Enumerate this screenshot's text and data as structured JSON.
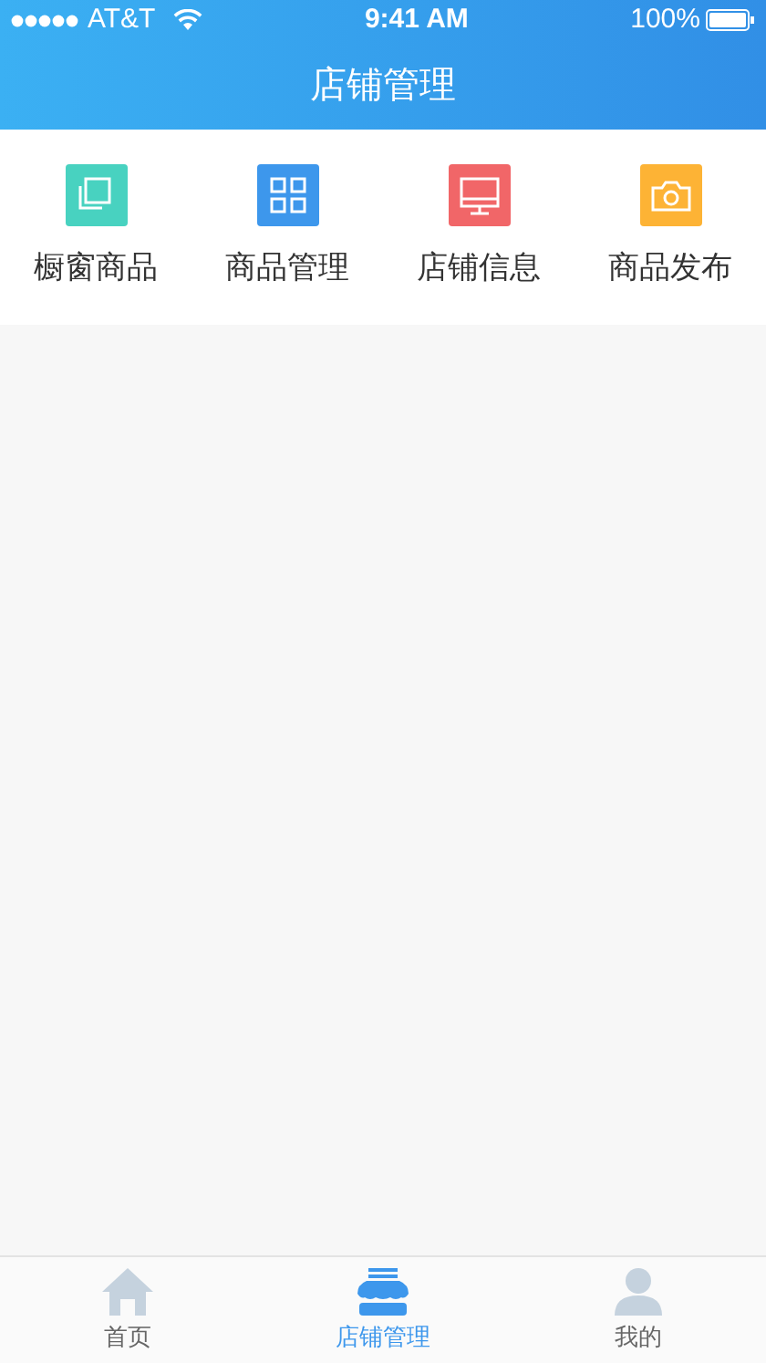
{
  "status_bar": {
    "carrier": "AT&T",
    "time": "9:41 AM",
    "battery": "100%"
  },
  "header": {
    "title": "店铺管理"
  },
  "menu": [
    {
      "label": "橱窗商品",
      "kind": "copy",
      "color": "#48d2c0"
    },
    {
      "label": "商品管理",
      "kind": "grid",
      "color": "#3d97ec"
    },
    {
      "label": "店铺信息",
      "kind": "monitor",
      "color": "#f16668"
    },
    {
      "label": "商品发布",
      "kind": "camera",
      "color": "#fdb335"
    }
  ],
  "tab_bar": [
    {
      "label": "首页",
      "kind": "home",
      "selected": false
    },
    {
      "label": "店铺管理",
      "kind": "shop",
      "selected": true
    },
    {
      "label": "我的",
      "kind": "user",
      "selected": false
    }
  ]
}
